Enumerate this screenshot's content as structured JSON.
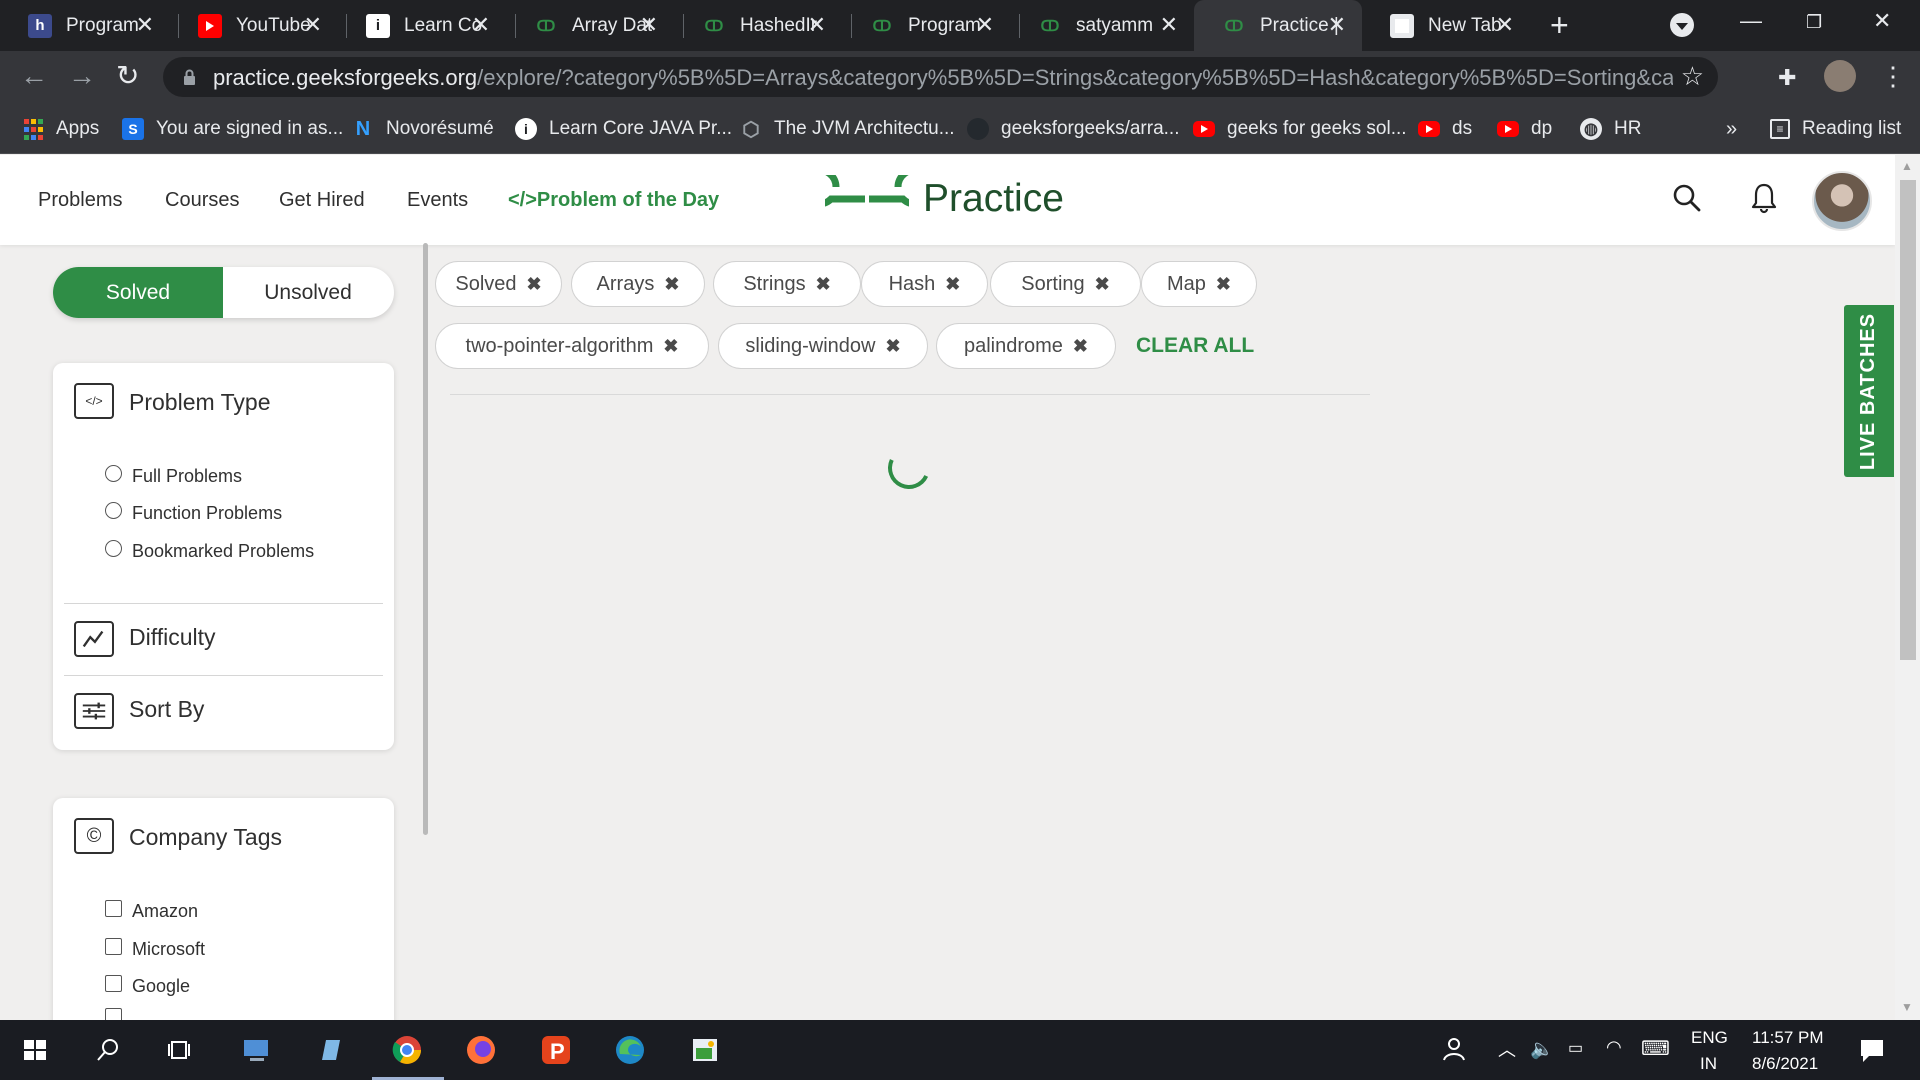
{
  "browser": {
    "tabs": [
      {
        "title": "Program",
        "icon": "h-icon"
      },
      {
        "title": "YouTube",
        "icon": "youtube-icon"
      },
      {
        "title": "Learn Co",
        "icon": "learn-icon"
      },
      {
        "title": "Array Dat",
        "icon": "gfg-icon"
      },
      {
        "title": "HashedIr",
        "icon": "gfg-icon"
      },
      {
        "title": "Program",
        "icon": "gfg-icon"
      },
      {
        "title": "satyamm",
        "icon": "gfg-icon"
      },
      {
        "title": "Practice |",
        "icon": "gfg-icon",
        "active": true
      },
      {
        "title": "New Tab",
        "icon": "chrome-icon"
      }
    ],
    "url_host": "practice.geeksforgeeks.org",
    "url_path": "/explore/?category%5B%5D=Arrays&category%5B%5D=Strings&category%5B%5D=Hash&category%5B%5D=Sorting&category%5...",
    "bookmarks": [
      {
        "label": "Apps",
        "icon": "apps-grid-icon"
      },
      {
        "label": "You are signed in as...",
        "icon": "s-icon"
      },
      {
        "label": "Novorésumé",
        "icon": "novoresume-icon"
      },
      {
        "label": "Learn Core JAVA Pr...",
        "icon": "learn-icon"
      },
      {
        "label": "The JVM Architectu...",
        "icon": "cube-icon"
      },
      {
        "label": "geeksforgeeks/arra...",
        "icon": "github-icon"
      },
      {
        "label": "geeks for geeks sol...",
        "icon": "youtube-icon"
      },
      {
        "label": "ds",
        "icon": "youtube-icon"
      },
      {
        "label": "dp",
        "icon": "youtube-icon"
      },
      {
        "label": "HR",
        "icon": "globe-icon"
      }
    ],
    "bookmarks_more": "»",
    "reading_list": "Reading list"
  },
  "header": {
    "nav": [
      "Problems",
      "Courses",
      "Get Hired",
      "Events"
    ],
    "potd": "Problem of the Day",
    "potd_icon": "</>",
    "logo_text": "Practice"
  },
  "filters": {
    "solved": "Solved",
    "unsolved": "Unsolved",
    "problem_type": {
      "title": "Problem Type",
      "icon": "</>",
      "options": [
        "Full Problems",
        "Function Problems",
        "Bookmarked Problems"
      ]
    },
    "difficulty": "Difficulty",
    "sort_by": "Sort By",
    "company_tags": {
      "title": "Company Tags",
      "icon": "©",
      "options": [
        "Amazon",
        "Microsoft",
        "Google"
      ]
    }
  },
  "chips": [
    "Solved",
    "Arrays",
    "Strings",
    "Hash",
    "Sorting",
    "Map",
    "two-pointer-algorithm",
    "sliding-window",
    "palindrome"
  ],
  "clear_all": "CLEAR ALL",
  "live_batches": "LIVE BATCHES",
  "taskbar": {
    "lang": "ENG",
    "region": "IN",
    "time": "11:57 PM",
    "date": "8/6/2021"
  },
  "colors": {
    "brand_green": "#2f8d46",
    "chrome_dark": "#202124",
    "chrome_toolbar": "#35363a",
    "page_bg": "#f0efee"
  }
}
